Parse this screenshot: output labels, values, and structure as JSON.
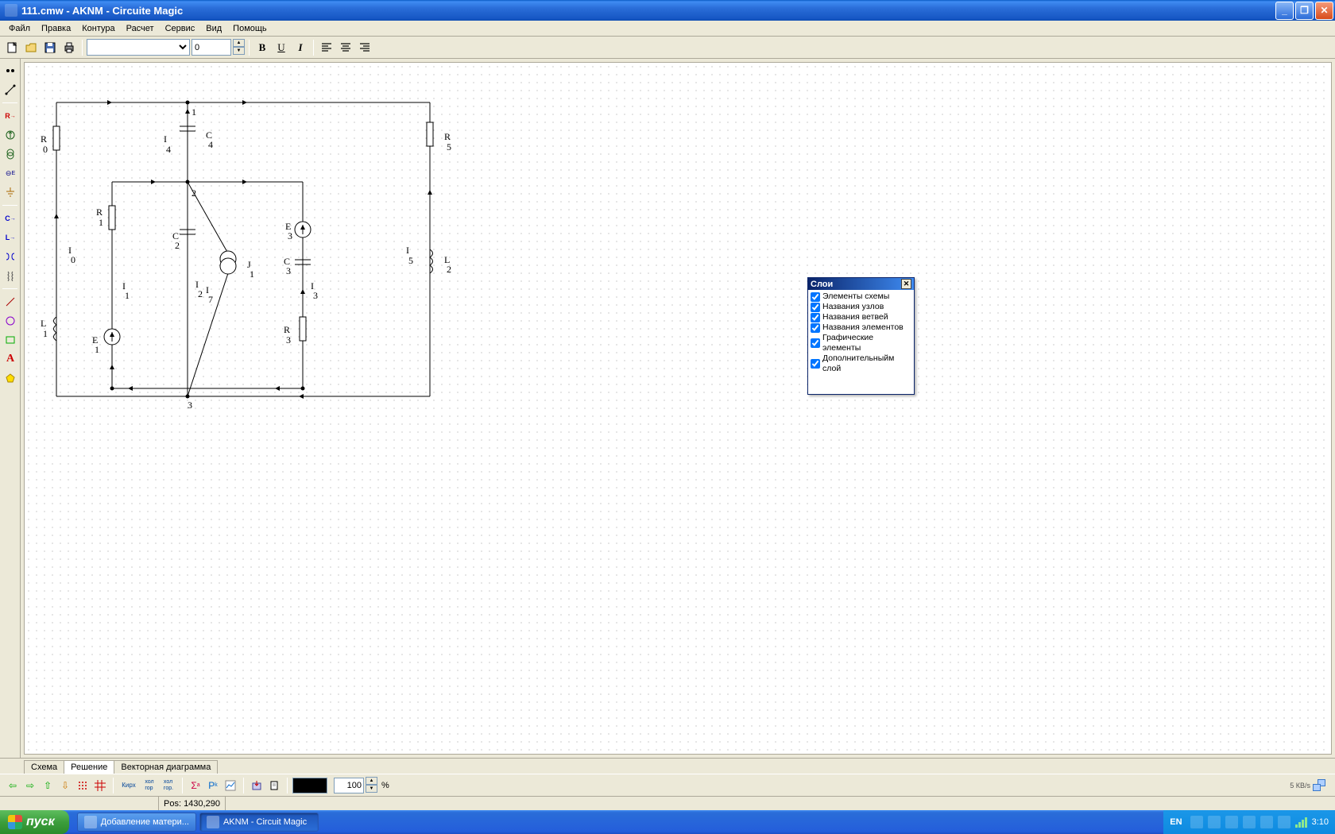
{
  "titlebar": {
    "title": "111.cmw - AKNM - Circuite Magic"
  },
  "menu": {
    "file": "Файл",
    "edit": "Правка",
    "contours": "Контура",
    "calculation": "Расчет",
    "service": "Сервис",
    "view": "Вид",
    "help": "Помощь"
  },
  "toolbar": {
    "font": "",
    "size": "0"
  },
  "layers": {
    "title": "Слои",
    "items": [
      "Элементы схемы",
      "Названия узлов",
      "Названия ветвей",
      "Названия элементов",
      "Графические элементы",
      "Дополнительныйм слой"
    ]
  },
  "tabs": {
    "schema": "Схема",
    "solution": "Решение",
    "vector": "Векторная диаграмма"
  },
  "navbar": {
    "kirch": "Кирх",
    "hor": "хол\nгор",
    "hol": "хол\nгор.",
    "zoom": "100",
    "percent": "%",
    "net_rate": "5 КВ/s"
  },
  "statusbar": {
    "pos": "Pos: 1430,290"
  },
  "taskbar": {
    "start": "пуск",
    "task1": "Добавление матери...",
    "task2": "AKNM - Circuit Magic",
    "lang": "EN",
    "time": "3:10"
  },
  "circuit_labels": {
    "n1": "1",
    "n2": "2",
    "n3": "3",
    "R0a": "R",
    "R0b": "0",
    "R1a": "R",
    "R1b": "1",
    "R3a": "R",
    "R3b": "3",
    "R5a": "R",
    "R5b": "5",
    "C2a": "C",
    "C2b": "2",
    "C3a": "C",
    "C3b": "3",
    "C4a": "C",
    "C4b": "4",
    "L1a": "L",
    "L1b": "1",
    "L2a": "L",
    "L2b": "2",
    "E1a": "E",
    "E1b": "1",
    "E3a": "E",
    "E3b": "3",
    "J1a": "J",
    "J1b": "1",
    "I0a": "I",
    "I0b": "0",
    "I1a": "I",
    "I1b": "1",
    "I2a": "I",
    "I2b": "2",
    "I3a": "I",
    "I3b": "3",
    "I4a": "I",
    "I4b": "4",
    "I5a": "I",
    "I5b": "5",
    "I7a": "I",
    "I7b": "7"
  }
}
